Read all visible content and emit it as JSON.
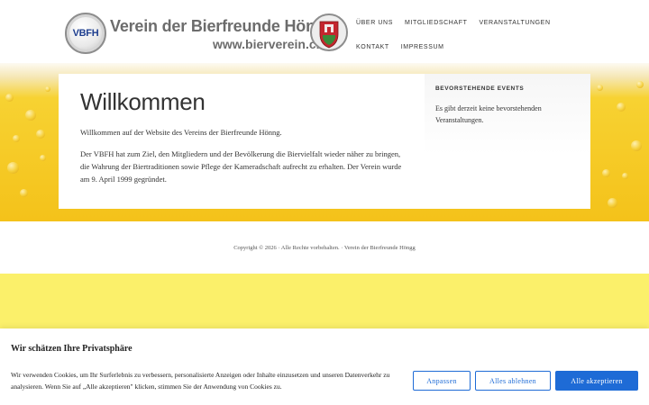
{
  "header": {
    "logo_badge": "VBFH",
    "logo_title": "Verein der Bierfreunde Höngg",
    "logo_url": "www.bierverein.ch",
    "nav": [
      "ÜBER UNS",
      "MITGLIEDSCHAFT",
      "VERANSTALTUNGEN",
      "KONTAKT",
      "IMPRESSUM"
    ]
  },
  "main": {
    "title": "Willkommen",
    "paragraphs": [
      "Willkommen auf der Website des Vereins der Bierfreunde Hönng.",
      "Der VBFH hat zum Ziel, den Mitgliedern und der Bevölkerung die Biervielfalt wieder näher zu bringen, die Wahrung der Biertraditionen sowie Pflege der Kameradschaft aufrecht zu erhalten. Der Verein wurde am 9. April 1999 gegründet."
    ]
  },
  "sidebar": {
    "title": "BEVORSTEHENDE EVENTS",
    "text": "Es gibt derzeit keine bevorstehenden Veranstaltungen."
  },
  "footer": {
    "copyright": "Copyright © 2026 · Alle Rechte vorbehalten. · Verein der Bierfreunde Höngg"
  },
  "cookie": {
    "title": "Wir schätzen Ihre Privatsphäre",
    "text": "Wir verwenden Cookies, um Ihr Surferlebnis zu verbessern, personalisierte Anzeigen oder Inhalte einzusetzen und unseren Datenverkehr zu analysieren. Wenn Sie auf „Alle akzeptieren\" klicken, stimmen Sie der Anwendung von Cookies zu.",
    "buttons": {
      "customize": "Anpassen",
      "reject": "Alles ablehnen",
      "accept": "Alle akzeptieren"
    }
  },
  "colors": {
    "accent": "#1e6bd6",
    "beer": "#f4c21a",
    "crest_red": "#c4262e",
    "crest_green": "#3a8a3a"
  }
}
